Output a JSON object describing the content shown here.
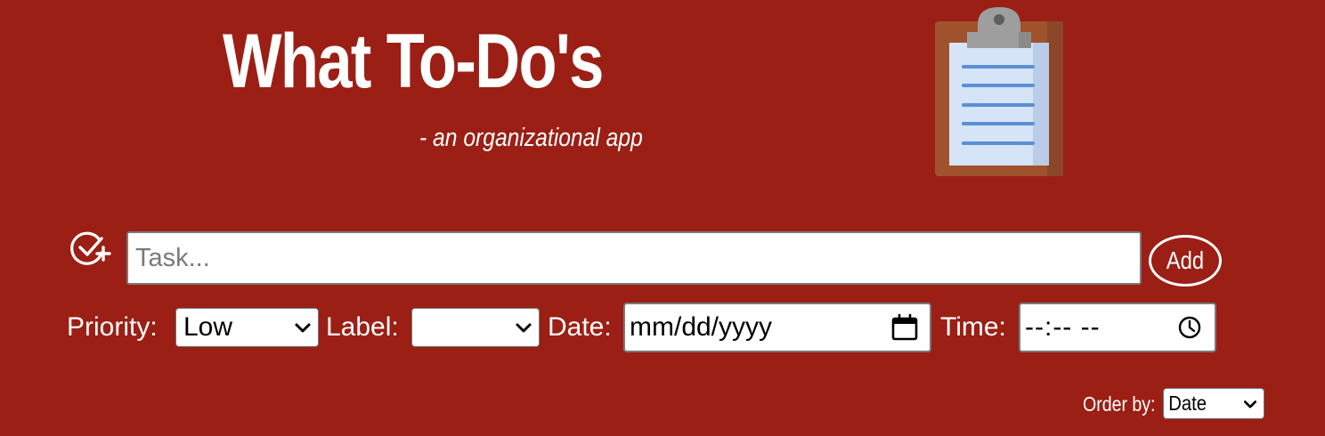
{
  "header": {
    "title": "What To-Do's",
    "subtitle": "- an organizational app",
    "logo_icon": "clipboard-icon"
  },
  "task_form": {
    "icon": "check-circle-plus-icon",
    "task_placeholder": "Task...",
    "task_value": "",
    "add_label": "Add"
  },
  "options": {
    "priority_label": "Priority:",
    "priority_value": "Low",
    "label_label": "Label:",
    "label_value": "",
    "date_label": "Date:",
    "date_value": "mm/dd/yyyy",
    "time_label": "Time:",
    "time_value": "--:-- --"
  },
  "ordering": {
    "order_label": "Order by:",
    "order_value": "Date"
  },
  "colors": {
    "background": "#9b1f15",
    "text": "#ffffff",
    "clipboard_board": "#a0522d",
    "clipboard_paper": "#d6e4f7",
    "clipboard_lines": "#5b8fd6",
    "clipboard_clip": "#9e9e9e"
  }
}
